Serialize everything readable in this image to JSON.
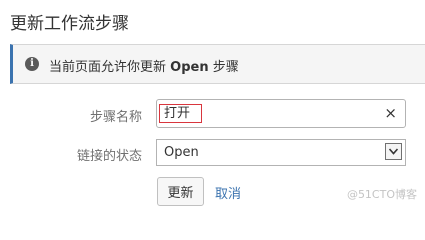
{
  "dialog": {
    "title": "更新工作流步骤"
  },
  "info_banner": {
    "icon": "info-icon",
    "icon_glyph": "i",
    "text_before": "当前页面允许你更新 ",
    "status_name": "Open",
    "text_after": " 步骤"
  },
  "form": {
    "step_name": {
      "label": "步骤名称",
      "value": "打开",
      "clear_icon": "×"
    },
    "linked_status": {
      "label": "链接的状态",
      "selected": "Open"
    }
  },
  "actions": {
    "update_label": "更新",
    "cancel_label": "取消"
  },
  "watermark": "@51CTO博客",
  "colors": {
    "link": "#3b73af",
    "highlight_box": "#d9363e",
    "banner_background": "#f5f5f5",
    "label_text": "#707070"
  }
}
